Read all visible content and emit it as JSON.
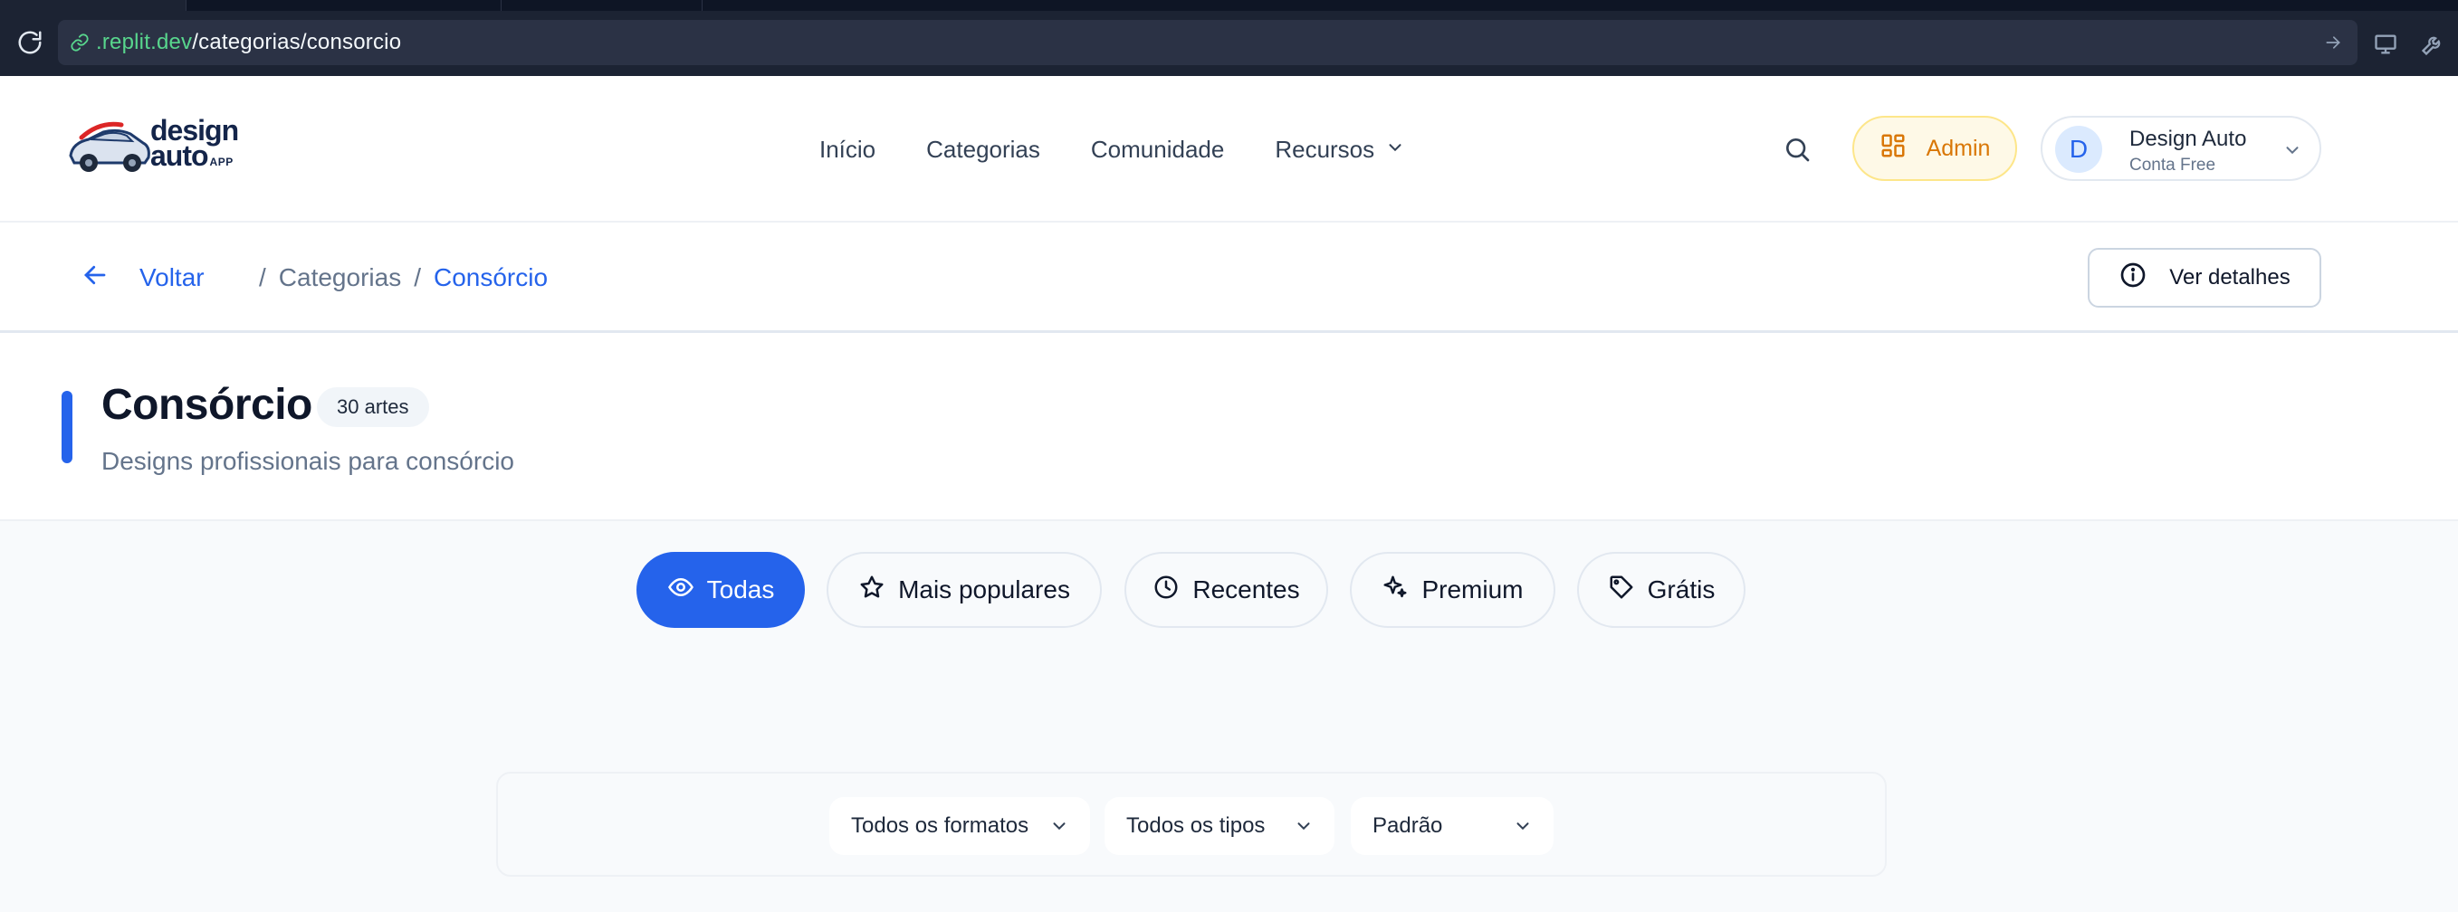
{
  "browser": {
    "url_host": ".replit.dev",
    "url_path": "/categorias/consorcio"
  },
  "header": {
    "logo_line1": "design",
    "logo_line2": "auto",
    "logo_line3": "APP",
    "nav": [
      "Início",
      "Categorias",
      "Comunidade",
      "Recursos"
    ],
    "admin_label": "Admin",
    "user": {
      "initial": "D",
      "name": "Design Auto",
      "plan": "Conta Free"
    }
  },
  "breadcrumb": {
    "back_label": "Voltar",
    "separator": "/",
    "parent": "Categorias",
    "current": "Consórcio",
    "details_label": "Ver detalhes"
  },
  "category": {
    "title": "Consórcio",
    "count": "30 artes",
    "subtitle": "Designs profissionais para consórcio"
  },
  "filters": [
    {
      "label": "Todas",
      "icon": "eye-icon",
      "active": true
    },
    {
      "label": "Mais populares",
      "icon": "star-icon",
      "active": false
    },
    {
      "label": "Recentes",
      "icon": "clock-icon",
      "active": false
    },
    {
      "label": "Premium",
      "icon": "sparkles-icon",
      "active": false
    },
    {
      "label": "Grátis",
      "icon": "tag-icon",
      "active": false
    }
  ],
  "selects": {
    "format": "Todos os formatos",
    "type": "Todos os tipos",
    "sort": "Padrão"
  },
  "colors": {
    "accent": "#2563eb",
    "admin": "#d97706",
    "url_host": "#58d68d"
  }
}
